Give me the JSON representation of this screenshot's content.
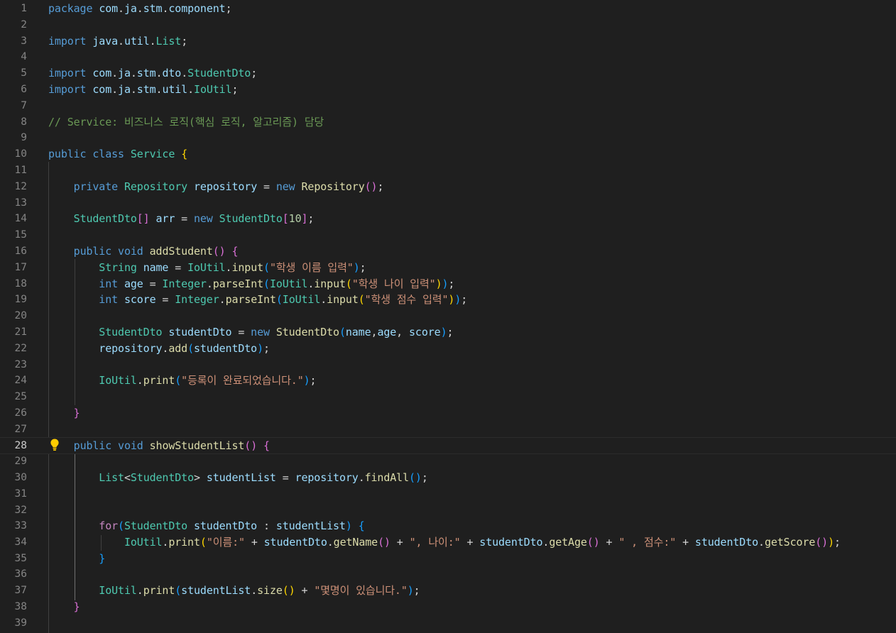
{
  "editor": {
    "active_line": 28,
    "lightbulb_icon": "lightbulb-icon",
    "colors": {
      "background": "#1f1f1f",
      "line_number": "#858585",
      "keyword": "#569cd6",
      "control": "#c586c0",
      "type": "#4ec9b0",
      "function": "#dcdcaa",
      "variable": "#9cdcfe",
      "string": "#ce9178",
      "number": "#b5cea8",
      "comment": "#6a9955",
      "bracket_level1": "#ffd700",
      "bracket_level2": "#da70d6",
      "bracket_level3": "#179fff"
    },
    "lines": [
      {
        "n": 1,
        "tokens": [
          [
            "kw",
            "package"
          ],
          [
            "pl",
            " "
          ],
          [
            "var",
            "com"
          ],
          [
            "pl",
            "."
          ],
          [
            "var",
            "ja"
          ],
          [
            "pl",
            "."
          ],
          [
            "var",
            "stm"
          ],
          [
            "pl",
            "."
          ],
          [
            "var",
            "component"
          ],
          [
            "pl",
            ";"
          ]
        ]
      },
      {
        "n": 2,
        "tokens": []
      },
      {
        "n": 3,
        "tokens": [
          [
            "kw",
            "import"
          ],
          [
            "pl",
            " "
          ],
          [
            "var",
            "java"
          ],
          [
            "pl",
            "."
          ],
          [
            "var",
            "util"
          ],
          [
            "pl",
            "."
          ],
          [
            "ty",
            "List"
          ],
          [
            "pl",
            ";"
          ]
        ]
      },
      {
        "n": 4,
        "tokens": []
      },
      {
        "n": 5,
        "tokens": [
          [
            "kw",
            "import"
          ],
          [
            "pl",
            " "
          ],
          [
            "var",
            "com"
          ],
          [
            "pl",
            "."
          ],
          [
            "var",
            "ja"
          ],
          [
            "pl",
            "."
          ],
          [
            "var",
            "stm"
          ],
          [
            "pl",
            "."
          ],
          [
            "var",
            "dto"
          ],
          [
            "pl",
            "."
          ],
          [
            "ty",
            "StudentDto"
          ],
          [
            "pl",
            ";"
          ]
        ]
      },
      {
        "n": 6,
        "tokens": [
          [
            "kw",
            "import"
          ],
          [
            "pl",
            " "
          ],
          [
            "var",
            "com"
          ],
          [
            "pl",
            "."
          ],
          [
            "var",
            "ja"
          ],
          [
            "pl",
            "."
          ],
          [
            "var",
            "stm"
          ],
          [
            "pl",
            "."
          ],
          [
            "var",
            "util"
          ],
          [
            "pl",
            "."
          ],
          [
            "ty",
            "IoUtil"
          ],
          [
            "pl",
            ";"
          ]
        ]
      },
      {
        "n": 7,
        "tokens": []
      },
      {
        "n": 8,
        "tokens": [
          [
            "cm",
            "// Service: 비즈니스 로직(핵심 로직, 알고리즘) 담당"
          ]
        ]
      },
      {
        "n": 9,
        "tokens": []
      },
      {
        "n": 10,
        "tokens": [
          [
            "kw",
            "public"
          ],
          [
            "pl",
            " "
          ],
          [
            "kw",
            "class"
          ],
          [
            "pl",
            " "
          ],
          [
            "ty",
            "Service"
          ],
          [
            "pl",
            " "
          ],
          [
            "b1",
            "{"
          ]
        ]
      },
      {
        "n": 11,
        "tokens": []
      },
      {
        "n": 12,
        "tokens": [
          [
            "pl",
            "    "
          ],
          [
            "kw",
            "private"
          ],
          [
            "pl",
            " "
          ],
          [
            "ty",
            "Repository"
          ],
          [
            "pl",
            " "
          ],
          [
            "var",
            "repository"
          ],
          [
            "pl",
            " = "
          ],
          [
            "kw",
            "new"
          ],
          [
            "pl",
            " "
          ],
          [
            "fn",
            "Repository"
          ],
          [
            "b2",
            "()"
          ],
          [
            "pl",
            ";"
          ]
        ]
      },
      {
        "n": 13,
        "tokens": []
      },
      {
        "n": 14,
        "tokens": [
          [
            "pl",
            "    "
          ],
          [
            "ty",
            "StudentDto"
          ],
          [
            "b2",
            "[]"
          ],
          [
            "pl",
            " "
          ],
          [
            "var",
            "arr"
          ],
          [
            "pl",
            " = "
          ],
          [
            "kw",
            "new"
          ],
          [
            "pl",
            " "
          ],
          [
            "ty",
            "StudentDto"
          ],
          [
            "b2",
            "["
          ],
          [
            "num",
            "10"
          ],
          [
            "b2",
            "]"
          ],
          [
            "pl",
            ";"
          ]
        ]
      },
      {
        "n": 15,
        "tokens": []
      },
      {
        "n": 16,
        "tokens": [
          [
            "pl",
            "    "
          ],
          [
            "kw",
            "public"
          ],
          [
            "pl",
            " "
          ],
          [
            "kw",
            "void"
          ],
          [
            "pl",
            " "
          ],
          [
            "fn",
            "addStudent"
          ],
          [
            "b2",
            "()"
          ],
          [
            "pl",
            " "
          ],
          [
            "b2",
            "{"
          ]
        ]
      },
      {
        "n": 17,
        "tokens": [
          [
            "pl",
            "        "
          ],
          [
            "ty",
            "String"
          ],
          [
            "pl",
            " "
          ],
          [
            "var",
            "name"
          ],
          [
            "pl",
            " = "
          ],
          [
            "ty",
            "IoUtil"
          ],
          [
            "pl",
            "."
          ],
          [
            "fn",
            "input"
          ],
          [
            "b3",
            "("
          ],
          [
            "str",
            "\"학생 이름 입력\""
          ],
          [
            "b3",
            ")"
          ],
          [
            "pl",
            ";"
          ]
        ]
      },
      {
        "n": 18,
        "tokens": [
          [
            "pl",
            "        "
          ],
          [
            "kw",
            "int"
          ],
          [
            "pl",
            " "
          ],
          [
            "var",
            "age"
          ],
          [
            "pl",
            " = "
          ],
          [
            "ty",
            "Integer"
          ],
          [
            "pl",
            "."
          ],
          [
            "fn",
            "parseInt"
          ],
          [
            "b3",
            "("
          ],
          [
            "ty",
            "IoUtil"
          ],
          [
            "pl",
            "."
          ],
          [
            "fn",
            "input"
          ],
          [
            "b1",
            "("
          ],
          [
            "str",
            "\"학생 나이 입력\""
          ],
          [
            "b1",
            ")"
          ],
          [
            "b3",
            ")"
          ],
          [
            "pl",
            ";"
          ]
        ]
      },
      {
        "n": 19,
        "tokens": [
          [
            "pl",
            "        "
          ],
          [
            "kw",
            "int"
          ],
          [
            "pl",
            " "
          ],
          [
            "var",
            "score"
          ],
          [
            "pl",
            " = "
          ],
          [
            "ty",
            "Integer"
          ],
          [
            "pl",
            "."
          ],
          [
            "fn",
            "parseInt"
          ],
          [
            "b3",
            "("
          ],
          [
            "ty",
            "IoUtil"
          ],
          [
            "pl",
            "."
          ],
          [
            "fn",
            "input"
          ],
          [
            "b1",
            "("
          ],
          [
            "str",
            "\"학생 점수 입력\""
          ],
          [
            "b1",
            ")"
          ],
          [
            "b3",
            ")"
          ],
          [
            "pl",
            ";"
          ]
        ]
      },
      {
        "n": 20,
        "tokens": []
      },
      {
        "n": 21,
        "tokens": [
          [
            "pl",
            "        "
          ],
          [
            "ty",
            "StudentDto"
          ],
          [
            "pl",
            " "
          ],
          [
            "var",
            "studentDto"
          ],
          [
            "pl",
            " = "
          ],
          [
            "kw",
            "new"
          ],
          [
            "pl",
            " "
          ],
          [
            "fn",
            "StudentDto"
          ],
          [
            "b3",
            "("
          ],
          [
            "var",
            "name"
          ],
          [
            "pl",
            ","
          ],
          [
            "var",
            "age"
          ],
          [
            "pl",
            ", "
          ],
          [
            "var",
            "score"
          ],
          [
            "b3",
            ")"
          ],
          [
            "pl",
            ";"
          ]
        ]
      },
      {
        "n": 22,
        "tokens": [
          [
            "pl",
            "        "
          ],
          [
            "var",
            "repository"
          ],
          [
            "pl",
            "."
          ],
          [
            "fn",
            "add"
          ],
          [
            "b3",
            "("
          ],
          [
            "var",
            "studentDto"
          ],
          [
            "b3",
            ")"
          ],
          [
            "pl",
            ";"
          ]
        ]
      },
      {
        "n": 23,
        "tokens": []
      },
      {
        "n": 24,
        "tokens": [
          [
            "pl",
            "        "
          ],
          [
            "ty",
            "IoUtil"
          ],
          [
            "pl",
            "."
          ],
          [
            "fn",
            "print"
          ],
          [
            "b3",
            "("
          ],
          [
            "str",
            "\"등록이 완료되었습니다.\""
          ],
          [
            "b3",
            ")"
          ],
          [
            "pl",
            ";"
          ]
        ]
      },
      {
        "n": 25,
        "tokens": []
      },
      {
        "n": 26,
        "tokens": [
          [
            "pl",
            "    "
          ],
          [
            "b2",
            "}"
          ]
        ]
      },
      {
        "n": 27,
        "tokens": []
      },
      {
        "n": 28,
        "tokens": [
          [
            "pl",
            "    "
          ],
          [
            "kw",
            "public"
          ],
          [
            "pl",
            " "
          ],
          [
            "kw",
            "void"
          ],
          [
            "pl",
            " "
          ],
          [
            "fn",
            "showStudentList"
          ],
          [
            "b2",
            "()"
          ],
          [
            "pl",
            " "
          ],
          [
            "b2",
            "{"
          ]
        ]
      },
      {
        "n": 29,
        "tokens": []
      },
      {
        "n": 30,
        "tokens": [
          [
            "pl",
            "        "
          ],
          [
            "ty",
            "List"
          ],
          [
            "pl",
            "<"
          ],
          [
            "ty",
            "StudentDto"
          ],
          [
            "pl",
            "> "
          ],
          [
            "var",
            "studentList"
          ],
          [
            "pl",
            " = "
          ],
          [
            "var",
            "repository"
          ],
          [
            "pl",
            "."
          ],
          [
            "fn",
            "findAll"
          ],
          [
            "b3",
            "()"
          ],
          [
            "pl",
            ";"
          ]
        ]
      },
      {
        "n": 31,
        "tokens": []
      },
      {
        "n": 32,
        "tokens": []
      },
      {
        "n": 33,
        "tokens": [
          [
            "pl",
            "        "
          ],
          [
            "ctl",
            "for"
          ],
          [
            "b3",
            "("
          ],
          [
            "ty",
            "StudentDto"
          ],
          [
            "pl",
            " "
          ],
          [
            "var",
            "studentDto"
          ],
          [
            "pl",
            " : "
          ],
          [
            "var",
            "studentList"
          ],
          [
            "b3",
            ")"
          ],
          [
            "pl",
            " "
          ],
          [
            "b3",
            "{"
          ]
        ]
      },
      {
        "n": 34,
        "tokens": [
          [
            "pl",
            "            "
          ],
          [
            "ty",
            "IoUtil"
          ],
          [
            "pl",
            "."
          ],
          [
            "fn",
            "print"
          ],
          [
            "b1",
            "("
          ],
          [
            "str",
            "\"이름:\""
          ],
          [
            "pl",
            " + "
          ],
          [
            "var",
            "studentDto"
          ],
          [
            "pl",
            "."
          ],
          [
            "fn",
            "getName"
          ],
          [
            "b2",
            "()"
          ],
          [
            "pl",
            " + "
          ],
          [
            "str",
            "\", 나이:\""
          ],
          [
            "pl",
            " + "
          ],
          [
            "var",
            "studentDto"
          ],
          [
            "pl",
            "."
          ],
          [
            "fn",
            "getAge"
          ],
          [
            "b2",
            "()"
          ],
          [
            "pl",
            " + "
          ],
          [
            "str",
            "\" , 점수:\""
          ],
          [
            "pl",
            " + "
          ],
          [
            "var",
            "studentDto"
          ],
          [
            "pl",
            "."
          ],
          [
            "fn",
            "getScore"
          ],
          [
            "b2",
            "()"
          ],
          [
            "b1",
            ")"
          ],
          [
            "pl",
            ";"
          ]
        ]
      },
      {
        "n": 35,
        "tokens": [
          [
            "pl",
            "        "
          ],
          [
            "b3",
            "}"
          ]
        ]
      },
      {
        "n": 36,
        "tokens": []
      },
      {
        "n": 37,
        "tokens": [
          [
            "pl",
            "        "
          ],
          [
            "ty",
            "IoUtil"
          ],
          [
            "pl",
            "."
          ],
          [
            "fn",
            "print"
          ],
          [
            "b3",
            "("
          ],
          [
            "var",
            "studentList"
          ],
          [
            "pl",
            "."
          ],
          [
            "fn",
            "size"
          ],
          [
            "b1",
            "()"
          ],
          [
            "pl",
            " + "
          ],
          [
            "str",
            "\"몇명이 있습니다.\""
          ],
          [
            "b3",
            ")"
          ],
          [
            "pl",
            ";"
          ]
        ]
      },
      {
        "n": 38,
        "tokens": [
          [
            "pl",
            "    "
          ],
          [
            "b2",
            "}"
          ]
        ]
      },
      {
        "n": 39,
        "tokens": []
      }
    ]
  }
}
